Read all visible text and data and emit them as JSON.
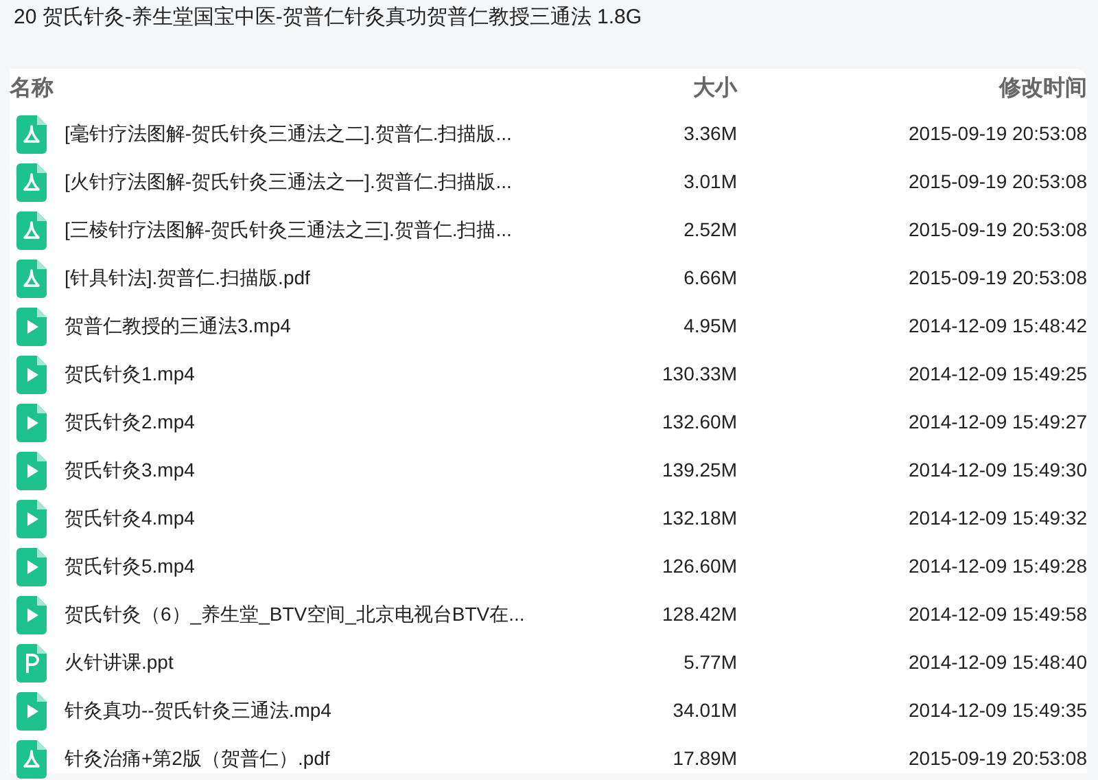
{
  "title": "20 贺氏针灸-养生堂国宝中医-贺普仁针灸真功贺普仁教授三通法 1.8G",
  "columns": [
    "名称",
    "大小",
    "修改时间"
  ],
  "files": [
    {
      "kind": "pdf",
      "name": "[毫针疗法图解-贺氏针灸三通法之二].贺普仁.扫描版...",
      "size": "3.36M",
      "modified": "2015-09-19 20:53:08"
    },
    {
      "kind": "pdf",
      "name": "[火针疗法图解-贺氏针灸三通法之一].贺普仁.扫描版...",
      "size": "3.01M",
      "modified": "2015-09-19 20:53:08"
    },
    {
      "kind": "pdf",
      "name": "[三棱针疗法图解-贺氏针灸三通法之三].贺普仁.扫描...",
      "size": "2.52M",
      "modified": "2015-09-19 20:53:08"
    },
    {
      "kind": "pdf",
      "name": "[针具针法].贺普仁.扫描版.pdf",
      "size": "6.66M",
      "modified": "2015-09-19 20:53:08"
    },
    {
      "kind": "video",
      "name": "贺普仁教授的三通法3.mp4",
      "size": "4.95M",
      "modified": "2014-12-09 15:48:42"
    },
    {
      "kind": "video",
      "name": "贺氏针灸1.mp4",
      "size": "130.33M",
      "modified": "2014-12-09 15:49:25"
    },
    {
      "kind": "video",
      "name": "贺氏针灸2.mp4",
      "size": "132.60M",
      "modified": "2014-12-09 15:49:27"
    },
    {
      "kind": "video",
      "name": "贺氏针灸3.mp4",
      "size": "139.25M",
      "modified": "2014-12-09 15:49:30"
    },
    {
      "kind": "video",
      "name": "贺氏针灸4.mp4",
      "size": "132.18M",
      "modified": "2014-12-09 15:49:32"
    },
    {
      "kind": "video",
      "name": "贺氏针灸5.mp4",
      "size": "126.60M",
      "modified": "2014-12-09 15:49:28"
    },
    {
      "kind": "video",
      "name": "贺氏针灸（6）_养生堂_BTV空间_北京电视台BTV在...",
      "size": "128.42M",
      "modified": "2014-12-09 15:49:58"
    },
    {
      "kind": "ppt",
      "name": "火针讲课.ppt",
      "size": "5.77M",
      "modified": "2014-12-09 15:48:40"
    },
    {
      "kind": "video",
      "name": "针灸真功--贺氏针灸三通法.mp4",
      "size": "34.01M",
      "modified": "2014-12-09 15:49:35"
    },
    {
      "kind": "pdf",
      "name": "针灸治痛+第2版（贺普仁）.pdf",
      "size": "17.89M",
      "modified": "2015-09-19 20:53:08"
    }
  ]
}
